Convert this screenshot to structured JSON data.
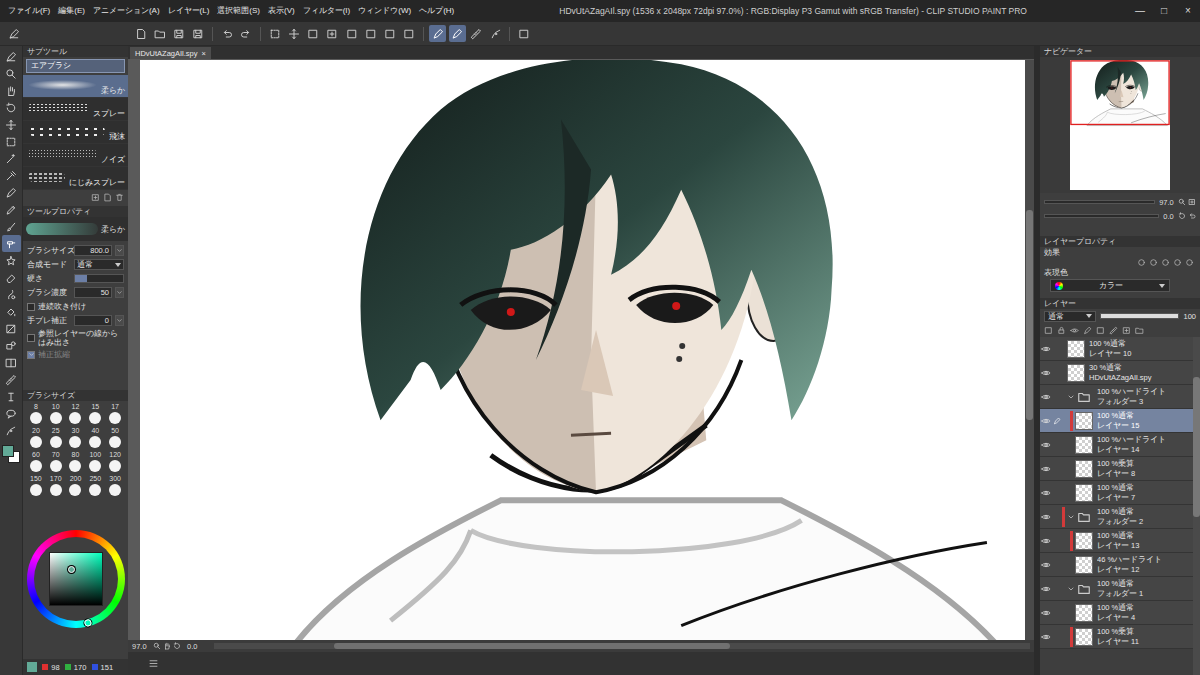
{
  "window": {
    "title": "HDvUtAZagAIl.spy (1536 x 2048px 72dpi 97.0%) : RGB:Display P3 Gamut with sRGB Transfer) - CLIP STUDIO PAINT PRO",
    "controls": [
      "—",
      "□",
      "×"
    ]
  },
  "menu": [
    "ファイル(F)",
    "編集(E)",
    "アニメーション(A)",
    "レイヤー(L)",
    "選択範囲(S)",
    "表示(V)",
    "フィルター(I)",
    "ウィンドウ(W)",
    "ヘルプ(H)"
  ],
  "command_bar": [
    {
      "on": false
    },
    {
      "on": false
    },
    {
      "on": false
    },
    {
      "on": false
    },
    {
      "on": false
    },
    {
      "on": false
    },
    {
      "on": false
    },
    {
      "on": false
    },
    {
      "on": false
    },
    {
      "on": false
    },
    {
      "on": false
    },
    {
      "on": false
    },
    {
      "on": false
    },
    {
      "on": false
    },
    {
      "on": true
    },
    {
      "on": true
    },
    {
      "on": false
    },
    {
      "on": false
    },
    {
      "on": false
    }
  ],
  "tools": [
    {
      "selected": false
    },
    {
      "selected": false
    },
    {
      "selected": false
    },
    {
      "selected": false
    },
    {
      "selected": false
    },
    {
      "selected": false
    },
    {
      "selected": false
    },
    {
      "selected": false
    },
    {
      "selected": false
    },
    {
      "selected": false
    },
    {
      "selected": false
    },
    {
      "selected": true
    },
    {
      "selected": false
    },
    {
      "selected": false
    },
    {
      "selected": false
    },
    {
      "selected": false
    },
    {
      "selected": false
    },
    {
      "selected": false
    },
    {
      "selected": false
    },
    {
      "selected": false
    },
    {
      "selected": false
    },
    {
      "selected": false
    },
    {
      "selected": false
    }
  ],
  "subtool": {
    "title": "サブツール",
    "group": "エアブラシ",
    "brushes": [
      {
        "label": "柔らか",
        "selected": true
      },
      {
        "label": "スプレー",
        "selected": false
      },
      {
        "label": "飛沫",
        "selected": false
      },
      {
        "label": "ノイズ",
        "selected": false
      },
      {
        "label": "にじみスプレー",
        "selected": false
      }
    ]
  },
  "tool_property": {
    "title": "ツールプロパティ",
    "preset": "柔らか",
    "rows": [
      {
        "kind": "number",
        "label": "ブラシサイズ",
        "value": "800.0"
      },
      {
        "kind": "select",
        "label": "合成モード",
        "value": "通常"
      },
      {
        "kind": "slider",
        "label": "硬さ",
        "level": 0.25
      },
      {
        "kind": "number",
        "label": "ブラシ濃度",
        "value": "50"
      },
      {
        "kind": "check",
        "label": "連続吹き付け",
        "checked": false,
        "disabled": false
      },
      {
        "kind": "number",
        "label": "手ブレ補正",
        "value": "0"
      },
      {
        "kind": "check",
        "label": "参照レイヤーの線からはみ出さ",
        "checked": false,
        "disabled": false
      },
      {
        "kind": "check",
        "label": "補正拡縮",
        "checked": true,
        "disabled": true
      }
    ]
  },
  "brush_size": {
    "title": "ブラシサイズ",
    "sizes": [
      {
        "label": "8",
        "selected": false
      },
      {
        "label": "10",
        "selected": false
      },
      {
        "label": "12",
        "selected": false
      },
      {
        "label": "15",
        "selected": false
      },
      {
        "label": "17",
        "selected": false
      },
      {
        "label": "20",
        "selected": false
      },
      {
        "label": "25",
        "selected": false
      },
      {
        "label": "30",
        "selected": false
      },
      {
        "label": "40",
        "selected": false
      },
      {
        "label": "50",
        "selected": false
      },
      {
        "label": "60",
        "selected": false
      },
      {
        "label": "70",
        "selected": false
      },
      {
        "label": "80",
        "selected": false
      },
      {
        "label": "100",
        "selected": false
      },
      {
        "label": "120",
        "selected": false
      },
      {
        "label": "150",
        "selected": false
      },
      {
        "label": "170",
        "selected": false
      },
      {
        "label": "200",
        "selected": false
      },
      {
        "label": "250",
        "selected": false
      },
      {
        "label": "300",
        "selected": false
      }
    ]
  },
  "color": {
    "r": "98",
    "g": "170",
    "b": "151"
  },
  "document_tab": {
    "label": "HDvUtAZagAIl.spy",
    "close": "×"
  },
  "status": {
    "zoom": "97.0",
    "angle": "0.0"
  },
  "navigator": {
    "title": "ナビゲーター",
    "zoom": "97.0",
    "angle": "0.0"
  },
  "layer_property": {
    "title": "レイヤープロパティ",
    "effect_label": "効果",
    "color_label": "表現色",
    "color_value": "カラー"
  },
  "layers": {
    "title": "レイヤー",
    "blend": "通常",
    "opacity": "100",
    "items": [
      {
        "kind": "layer",
        "blend": "100 %通常",
        "name": "レイヤー 10",
        "visible": true,
        "selected": false,
        "clipped": false
      },
      {
        "kind": "layer",
        "blend": "30 %通常",
        "name": "HDvUtAZagAIl.spy",
        "visible": true,
        "selected": false,
        "clipped": false
      },
      {
        "kind": "folder",
        "blend": "100 %ハードライト",
        "name": "フォルダー 3",
        "visible": true,
        "selected": false,
        "clipped": false,
        "expanded": true,
        "children": [
          {
            "kind": "layer",
            "blend": "100 %通常",
            "name": "レイヤー 15",
            "visible": true,
            "selected": true,
            "clipped": true
          },
          {
            "kind": "layer",
            "blend": "100 %ハードライト",
            "name": "レイヤー 14",
            "visible": true,
            "selected": false,
            "clipped": false
          },
          {
            "kind": "layer",
            "blend": "100 %乗算",
            "name": "レイヤー 8",
            "visible": true,
            "selected": false,
            "clipped": false
          },
          {
            "kind": "layer",
            "blend": "100 %通常",
            "name": "レイヤー 7",
            "visible": true,
            "selected": false,
            "clipped": false
          }
        ]
      },
      {
        "kind": "folder",
        "blend": "100 %通常",
        "name": "フォルダー 2",
        "visible": true,
        "selected": false,
        "clipped": true,
        "expanded": true,
        "children": [
          {
            "kind": "layer",
            "blend": "100 %通常",
            "name": "レイヤー 13",
            "visible": true,
            "selected": false,
            "clipped": true
          },
          {
            "kind": "layer",
            "blend": "46 %ハードライト",
            "name": "レイヤー 12",
            "visible": true,
            "selected": false,
            "clipped": false
          }
        ]
      },
      {
        "kind": "folder",
        "blend": "100 %通常",
        "name": "フォルダー 1",
        "visible": true,
        "selected": false,
        "clipped": false,
        "expanded": true,
        "children": [
          {
            "kind": "layer",
            "blend": "100 %通常",
            "name": "レイヤー 4",
            "visible": true,
            "selected": false,
            "clipped": false
          },
          {
            "kind": "layer",
            "blend": "100 %乗算",
            "name": "レイヤー 11",
            "visible": true,
            "selected": false,
            "clipped": true
          }
        ]
      }
    ]
  }
}
